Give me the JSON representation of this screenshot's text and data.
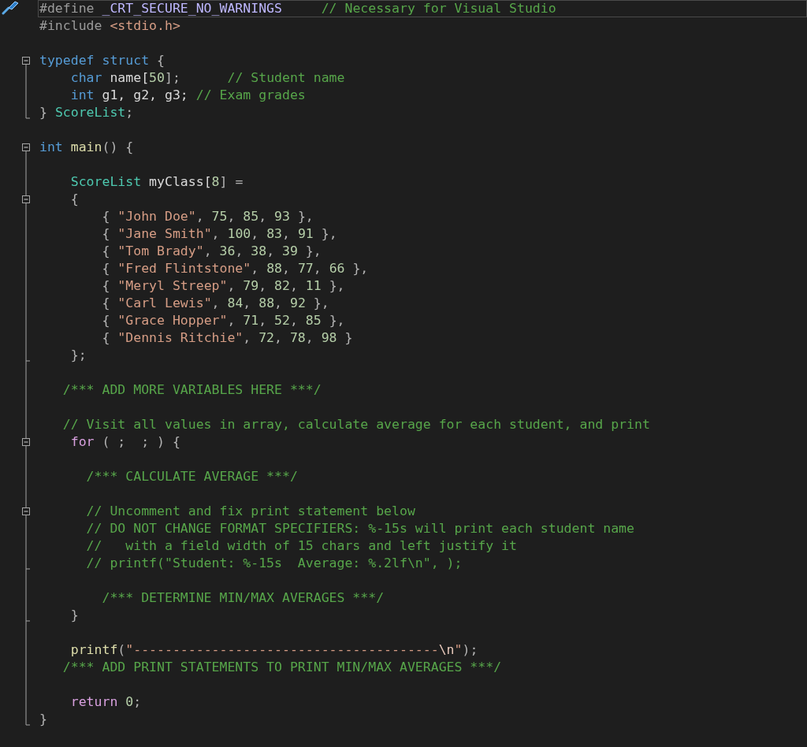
{
  "editor": {
    "lines": [
      {
        "current": true,
        "tokens": [
          {
            "text": "#define ",
            "kind": "preproc"
          },
          {
            "text": "_CRT_SECURE_NO_WARNINGS",
            "kind": "macro"
          },
          {
            "text": "     // Necessary for Visual Studio",
            "kind": "comment"
          }
        ]
      },
      {
        "tokens": [
          {
            "text": "#include ",
            "kind": "preproc"
          },
          {
            "text": "<stdio.h>",
            "kind": "string"
          }
        ]
      },
      {
        "kind": "blank"
      },
      {
        "kind": "fold",
        "tokens": [
          {
            "text": "typedef struct",
            "kind": "keyword"
          },
          {
            "text": " {",
            "kind": "punct"
          }
        ]
      },
      {
        "kind": "bar",
        "tokens": [
          {
            "text": "    char",
            "kind": "keyword"
          },
          {
            "text": " name[",
            "kind": "plain"
          },
          {
            "text": "50",
            "kind": "number"
          },
          {
            "text": "];",
            "kind": "punct"
          },
          {
            "text": "      // Student name",
            "kind": "comment"
          }
        ]
      },
      {
        "kind": "bar",
        "tokens": [
          {
            "text": "    int",
            "kind": "keyword"
          },
          {
            "text": " g1, g2, g3;",
            "kind": "plain"
          },
          {
            "text": " // Exam grades",
            "kind": "comment"
          }
        ]
      },
      {
        "kind": "end",
        "tokens": [
          {
            "text": "}",
            "kind": "punct"
          },
          {
            "text": " ScoreList",
            "kind": "type"
          },
          {
            "text": ";",
            "kind": "punct"
          }
        ]
      },
      {
        "kind": "blank"
      },
      {
        "kind": "fold",
        "tokens": [
          {
            "text": "int",
            "kind": "keyword"
          },
          {
            "text": " main",
            "kind": "function"
          },
          {
            "text": "() {",
            "kind": "punct"
          }
        ]
      },
      {
        "kind": "bar"
      },
      {
        "kind": "bar",
        "tokens": [
          {
            "text": "    ScoreList",
            "kind": "type"
          },
          {
            "text": " myClass[",
            "kind": "plain"
          },
          {
            "text": "8",
            "kind": "number"
          },
          {
            "text": "] =",
            "kind": "punct"
          }
        ]
      },
      {
        "kind": "fold",
        "tokens": [
          {
            "text": "    {",
            "kind": "punct"
          }
        ]
      },
      {
        "kind": "bar",
        "tokens": [
          {
            "text": "        {",
            "kind": "punct"
          },
          {
            "text": " \"John Doe\"",
            "kind": "string"
          },
          {
            "text": ",",
            "kind": "punct"
          },
          {
            "text": " 75",
            "kind": "number"
          },
          {
            "text": ",",
            "kind": "punct"
          },
          {
            "text": " 85",
            "kind": "number"
          },
          {
            "text": ",",
            "kind": "punct"
          },
          {
            "text": " 93",
            "kind": "number"
          },
          {
            "text": " },",
            "kind": "punct"
          }
        ]
      },
      {
        "kind": "bar",
        "tokens": [
          {
            "text": "        {",
            "kind": "punct"
          },
          {
            "text": " \"Jane Smith\"",
            "kind": "string"
          },
          {
            "text": ",",
            "kind": "punct"
          },
          {
            "text": " 100",
            "kind": "number"
          },
          {
            "text": ",",
            "kind": "punct"
          },
          {
            "text": " 83",
            "kind": "number"
          },
          {
            "text": ",",
            "kind": "punct"
          },
          {
            "text": " 91",
            "kind": "number"
          },
          {
            "text": " },",
            "kind": "punct"
          }
        ]
      },
      {
        "kind": "bar",
        "tokens": [
          {
            "text": "        {",
            "kind": "punct"
          },
          {
            "text": " \"Tom Brady\"",
            "kind": "string"
          },
          {
            "text": ",",
            "kind": "punct"
          },
          {
            "text": " 36",
            "kind": "number"
          },
          {
            "text": ",",
            "kind": "punct"
          },
          {
            "text": " 38",
            "kind": "number"
          },
          {
            "text": ",",
            "kind": "punct"
          },
          {
            "text": " 39",
            "kind": "number"
          },
          {
            "text": " },",
            "kind": "punct"
          }
        ]
      },
      {
        "kind": "bar",
        "tokens": [
          {
            "text": "        {",
            "kind": "punct"
          },
          {
            "text": " \"Fred Flintstone\"",
            "kind": "string"
          },
          {
            "text": ",",
            "kind": "punct"
          },
          {
            "text": " 88",
            "kind": "number"
          },
          {
            "text": ",",
            "kind": "punct"
          },
          {
            "text": " 77",
            "kind": "number"
          },
          {
            "text": ",",
            "kind": "punct"
          },
          {
            "text": " 66",
            "kind": "number"
          },
          {
            "text": " },",
            "kind": "punct"
          }
        ]
      },
      {
        "kind": "bar",
        "tokens": [
          {
            "text": "        {",
            "kind": "punct"
          },
          {
            "text": " \"Meryl Streep\"",
            "kind": "string"
          },
          {
            "text": ",",
            "kind": "punct"
          },
          {
            "text": " 79",
            "kind": "number"
          },
          {
            "text": ",",
            "kind": "punct"
          },
          {
            "text": " 82",
            "kind": "number"
          },
          {
            "text": ",",
            "kind": "punct"
          },
          {
            "text": " 11",
            "kind": "number"
          },
          {
            "text": " },",
            "kind": "punct"
          }
        ]
      },
      {
        "kind": "bar",
        "tokens": [
          {
            "text": "        {",
            "kind": "punct"
          },
          {
            "text": " \"Carl Lewis\"",
            "kind": "string"
          },
          {
            "text": ",",
            "kind": "punct"
          },
          {
            "text": " 84",
            "kind": "number"
          },
          {
            "text": ",",
            "kind": "punct"
          },
          {
            "text": " 88",
            "kind": "number"
          },
          {
            "text": ",",
            "kind": "punct"
          },
          {
            "text": " 92",
            "kind": "number"
          },
          {
            "text": " },",
            "kind": "punct"
          }
        ]
      },
      {
        "kind": "bar",
        "tokens": [
          {
            "text": "        {",
            "kind": "punct"
          },
          {
            "text": " \"Grace Hopper\"",
            "kind": "string"
          },
          {
            "text": ",",
            "kind": "punct"
          },
          {
            "text": " 71",
            "kind": "number"
          },
          {
            "text": ",",
            "kind": "punct"
          },
          {
            "text": " 52",
            "kind": "number"
          },
          {
            "text": ",",
            "kind": "punct"
          },
          {
            "text": " 85",
            "kind": "number"
          },
          {
            "text": " },",
            "kind": "punct"
          }
        ]
      },
      {
        "kind": "bar",
        "tokens": [
          {
            "text": "        {",
            "kind": "punct"
          },
          {
            "text": " \"Dennis Ritchie\"",
            "kind": "string"
          },
          {
            "text": ",",
            "kind": "punct"
          },
          {
            "text": " 72",
            "kind": "number"
          },
          {
            "text": ",",
            "kind": "punct"
          },
          {
            "text": " 78",
            "kind": "number"
          },
          {
            "text": ",",
            "kind": "punct"
          },
          {
            "text": " 98",
            "kind": "number"
          },
          {
            "text": " }",
            "kind": "punct"
          }
        ]
      },
      {
        "kind": "end",
        "tokens": [
          {
            "text": "    };",
            "kind": "punct"
          }
        ]
      },
      {
        "kind": "bar"
      },
      {
        "kind": "bar",
        "tokens": [
          {
            "text": "   /*** ADD MORE VARIABLES HERE ***/",
            "kind": "comment"
          }
        ]
      },
      {
        "kind": "bar"
      },
      {
        "kind": "bar",
        "tokens": [
          {
            "text": "   // Visit all values in array, calculate average for each student, and print",
            "kind": "comment"
          }
        ]
      },
      {
        "kind": "fold",
        "tokens": [
          {
            "text": "    for",
            "kind": "control"
          },
          {
            "text": " ( ;  ; ) {",
            "kind": "punct"
          }
        ]
      },
      {
        "kind": "bar"
      },
      {
        "kind": "bar",
        "tokens": [
          {
            "text": "      /*** CALCULATE AVERAGE ***/",
            "kind": "comment"
          }
        ]
      },
      {
        "kind": "bar"
      },
      {
        "kind": "fold",
        "tokens": [
          {
            "text": "      // Uncomment and fix print statement below",
            "kind": "comment"
          }
        ]
      },
      {
        "kind": "bar",
        "tokens": [
          {
            "text": "      // DO NOT CHANGE FORMAT SPECIFIERS: %-15s will print each student name",
            "kind": "comment"
          }
        ]
      },
      {
        "kind": "bar",
        "tokens": [
          {
            "text": "      //   with a field width of 15 chars and left justify it",
            "kind": "comment"
          }
        ]
      },
      {
        "kind": "end",
        "tokens": [
          {
            "text": "      // printf(\"Student: %-15s  Average: %.2lf\\n\", );",
            "kind": "comment"
          }
        ]
      },
      {
        "kind": "bar"
      },
      {
        "kind": "bar",
        "tokens": [
          {
            "text": "        /*** DETERMINE MIN/MAX AVERAGES ***/",
            "kind": "comment"
          }
        ]
      },
      {
        "kind": "end",
        "tokens": [
          {
            "text": "    }",
            "kind": "punct"
          }
        ]
      },
      {
        "kind": "bar"
      },
      {
        "kind": "bar",
        "tokens": [
          {
            "text": "    printf",
            "kind": "function"
          },
          {
            "text": "(",
            "kind": "punct"
          },
          {
            "text": "\"---------------------------------------",
            "kind": "string"
          },
          {
            "text": "\\n",
            "kind": "escape"
          },
          {
            "text": "\"",
            "kind": "string"
          },
          {
            "text": ");",
            "kind": "punct"
          }
        ]
      },
      {
        "kind": "bar",
        "tokens": [
          {
            "text": "   /*** ADD PRINT STATEMENTS TO PRINT MIN/MAX AVERAGES ***/",
            "kind": "comment"
          }
        ]
      },
      {
        "kind": "bar"
      },
      {
        "kind": "bar",
        "tokens": [
          {
            "text": "    return",
            "kind": "control"
          },
          {
            "text": " 0",
            "kind": "number"
          },
          {
            "text": ";",
            "kind": "punct"
          }
        ]
      },
      {
        "kind": "end",
        "tokens": [
          {
            "text": "}",
            "kind": "punct"
          }
        ]
      }
    ]
  }
}
